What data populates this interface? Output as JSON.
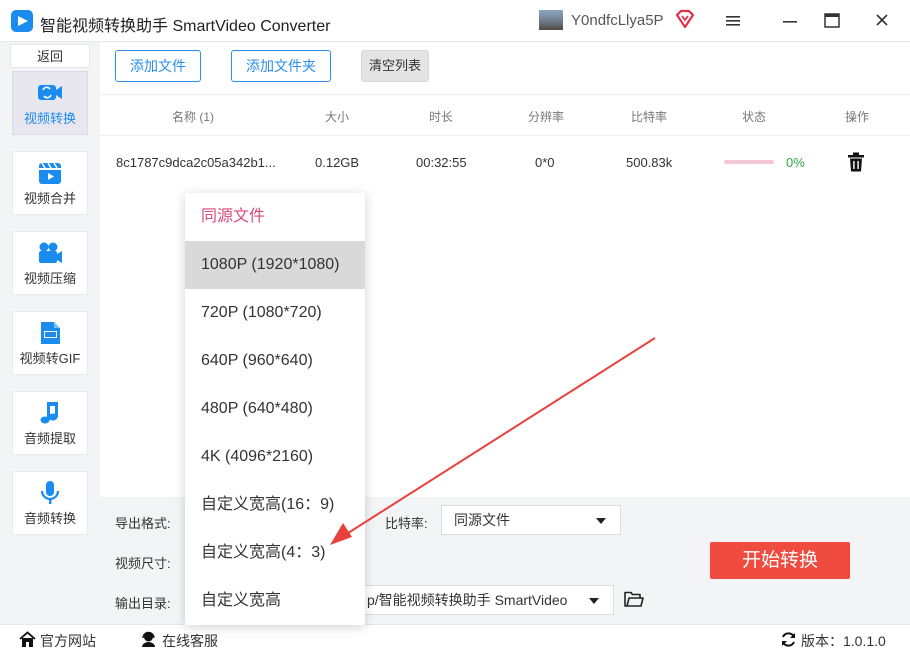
{
  "window": {
    "title": "智能视频转换助手 SmartVideo Converter",
    "user_name": "Y0ndfcLlya5P"
  },
  "sidebar": {
    "back_label": "返回",
    "items": [
      {
        "label": "视频转换",
        "icon": "video-convert-icon",
        "active": true
      },
      {
        "label": "视频合并",
        "icon": "video-merge-icon",
        "active": false
      },
      {
        "label": "视频压缩",
        "icon": "video-compress-icon",
        "active": false
      },
      {
        "label": "视频转GIF",
        "icon": "gif-icon",
        "active": false
      },
      {
        "label": "音频提取",
        "icon": "music-note-icon",
        "active": false
      },
      {
        "label": "音频转换",
        "icon": "microphone-icon",
        "active": false
      }
    ]
  },
  "toolbar": {
    "add_file": "添加文件",
    "add_folder": "添加文件夹",
    "clear_list": "清空列表"
  },
  "table": {
    "headers": [
      "名称 (1)",
      "大小",
      "时长",
      "分辨率",
      "比特率",
      "状态",
      "操作"
    ],
    "rows": [
      {
        "name": "8c1787c9dca2c05a342b1...",
        "size": "0.12GB",
        "duration": "00:32:55",
        "resolution": "0*0",
        "bitrate": "500.83k",
        "progress": 0,
        "progress_text": "0%"
      }
    ]
  },
  "settings": {
    "format_label": "导出格式:",
    "size_label": "视频尺寸:",
    "output_label": "输出目录:",
    "bitrate_label": "比特率:",
    "bitrate_value": "同源文件",
    "output_value": "p/智能视频转换助手 SmartVideo",
    "start_button": "开始转换"
  },
  "dropdown": {
    "options": [
      "同源文件",
      "1080P (1920*1080)",
      "720P (1080*720)",
      "640P (960*640)",
      "480P (640*480)",
      "4K (4096*2160)",
      "自定义宽高(16：9)",
      "自定义宽高(4：3)",
      "自定义宽高"
    ],
    "highlighted_index": 1
  },
  "footer": {
    "website": "官方网站",
    "support": "在线客服",
    "version": "版本：1.0.1.0"
  },
  "colors": {
    "accent_blue": "#1a8cf0",
    "start_red": "#f04b3f",
    "annotation_arrow": "#e8413c",
    "progress_green": "#2faa3f"
  }
}
